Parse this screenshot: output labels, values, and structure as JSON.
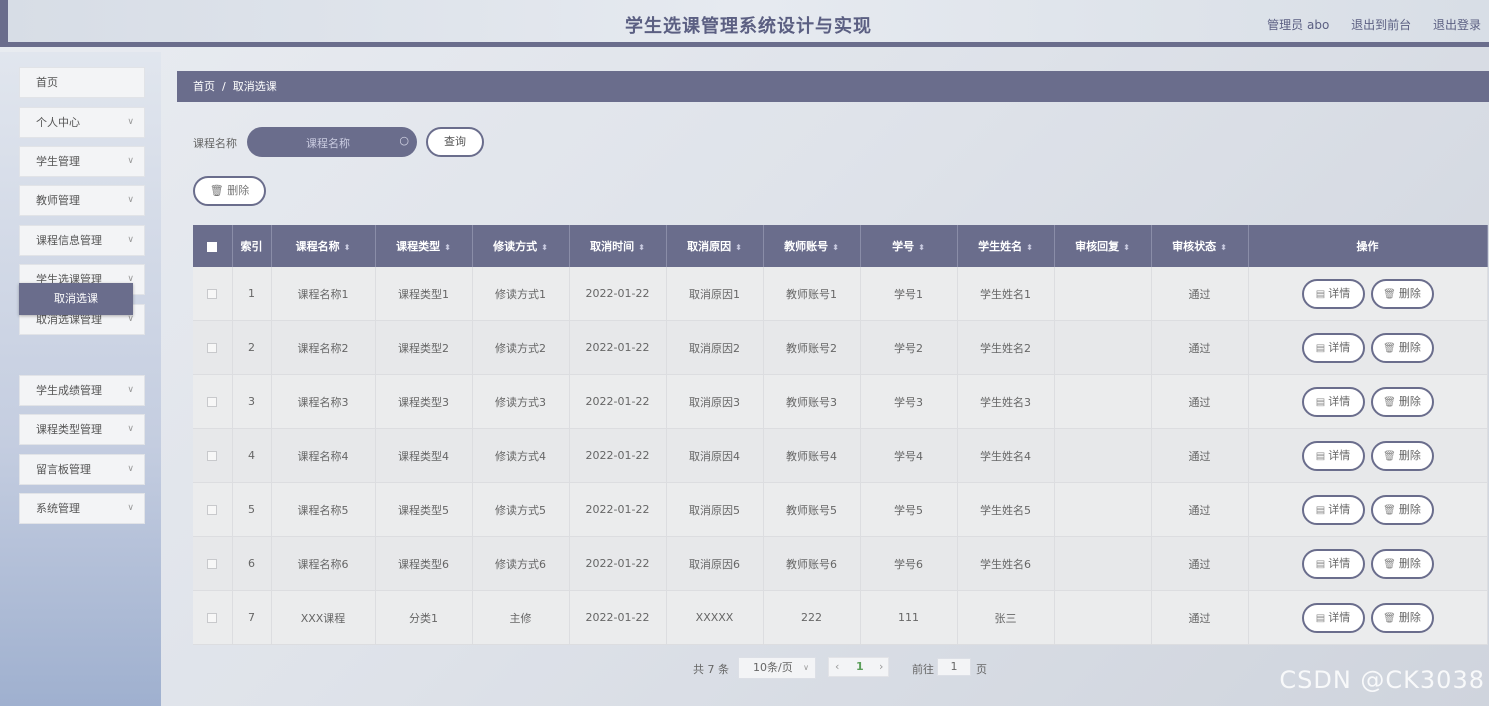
{
  "header": {
    "title": "学生选课管理系统设计与实现",
    "admin": "管理员 abo",
    "back_front": "退出到前台",
    "logout": "退出登录"
  },
  "sidebar": {
    "items": [
      {
        "label": "首页",
        "expandable": false
      },
      {
        "label": "个人中心",
        "expandable": true
      },
      {
        "label": "学生管理",
        "expandable": true
      },
      {
        "label": "教师管理",
        "expandable": true
      },
      {
        "label": "课程信息管理",
        "expandable": true
      },
      {
        "label": "学生选课管理",
        "expandable": true
      },
      {
        "label": "取消选课管理",
        "expandable": true
      },
      {
        "label": "学生成绩管理",
        "expandable": true
      },
      {
        "label": "课程类型管理",
        "expandable": true
      },
      {
        "label": "留言板管理",
        "expandable": true
      },
      {
        "label": "系统管理",
        "expandable": true
      }
    ],
    "active_sub": "取消选课"
  },
  "breadcrumb": {
    "home": "首页",
    "sep": "/",
    "current": "取消选课"
  },
  "search": {
    "label": "课程名称",
    "placeholder": "课程名称",
    "button": "查询"
  },
  "bulk_delete": "删除",
  "table": {
    "columns": [
      "索引",
      "课程名称",
      "课程类型",
      "修读方式",
      "取消时间",
      "取消原因",
      "教师账号",
      "学号",
      "学生姓名",
      "审核回复",
      "审核状态",
      "操作"
    ],
    "rows": [
      [
        "1",
        "课程名称1",
        "课程类型1",
        "修读方式1",
        "2022-01-22",
        "取消原因1",
        "教师账号1",
        "学号1",
        "学生姓名1",
        "",
        "通过"
      ],
      [
        "2",
        "课程名称2",
        "课程类型2",
        "修读方式2",
        "2022-01-22",
        "取消原因2",
        "教师账号2",
        "学号2",
        "学生姓名2",
        "",
        "通过"
      ],
      [
        "3",
        "课程名称3",
        "课程类型3",
        "修读方式3",
        "2022-01-22",
        "取消原因3",
        "教师账号3",
        "学号3",
        "学生姓名3",
        "",
        "通过"
      ],
      [
        "4",
        "课程名称4",
        "课程类型4",
        "修读方式4",
        "2022-01-22",
        "取消原因4",
        "教师账号4",
        "学号4",
        "学生姓名4",
        "",
        "通过"
      ],
      [
        "5",
        "课程名称5",
        "课程类型5",
        "修读方式5",
        "2022-01-22",
        "取消原因5",
        "教师账号5",
        "学号5",
        "学生姓名5",
        "",
        "通过"
      ],
      [
        "6",
        "课程名称6",
        "课程类型6",
        "修读方式6",
        "2022-01-22",
        "取消原因6",
        "教师账号6",
        "学号6",
        "学生姓名6",
        "",
        "通过"
      ],
      [
        "7",
        "XXX课程",
        "分类1",
        "主修",
        "2022-01-22",
        "XXXXX",
        "222",
        "111",
        "张三",
        "",
        "通过"
      ]
    ],
    "actions": {
      "detail": "详情",
      "delete": "删除"
    }
  },
  "pagination": {
    "total": "共 7 条",
    "page_size": "10条/页",
    "current_page": "1",
    "goto_label": "前往",
    "goto_value": "1",
    "page_unit": "页"
  },
  "watermark": "CSDN @CK3038"
}
